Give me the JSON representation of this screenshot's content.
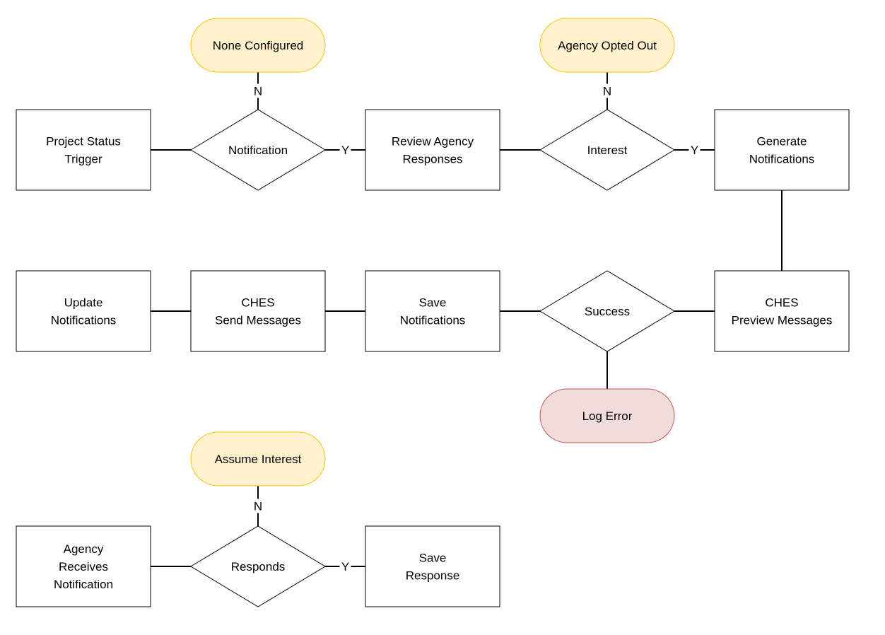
{
  "colors": {
    "terminator_fill": "#fff2cc",
    "terminator_stroke": "#f5c000",
    "error_fill": "#f2dcdb",
    "error_stroke": "#c0504d",
    "line": "#000000"
  },
  "nodes": {
    "project_status_trigger": {
      "type": "process",
      "lines": [
        "Project Status",
        "Trigger"
      ]
    },
    "notification": {
      "type": "decision",
      "lines": [
        "Notification"
      ]
    },
    "none_configured": {
      "type": "terminator",
      "lines": [
        "None Configured"
      ]
    },
    "review_agency_responses": {
      "type": "process",
      "lines": [
        "Review Agency",
        "Responses"
      ]
    },
    "interest": {
      "type": "decision",
      "lines": [
        "Interest"
      ]
    },
    "agency_opted_out": {
      "type": "terminator",
      "lines": [
        "Agency Opted Out"
      ]
    },
    "generate_notifications": {
      "type": "process",
      "lines": [
        "Generate",
        "Notifications"
      ]
    },
    "ches_preview_messages": {
      "type": "process",
      "lines": [
        "CHES",
        "Preview Messages"
      ]
    },
    "success": {
      "type": "decision",
      "lines": [
        "Success"
      ]
    },
    "log_error": {
      "type": "error",
      "lines": [
        "Log Error"
      ]
    },
    "save_notifications": {
      "type": "process",
      "lines": [
        "Save",
        "Notifications"
      ]
    },
    "ches_send_messages": {
      "type": "process",
      "lines": [
        "CHES",
        "Send Messages"
      ]
    },
    "update_notifications": {
      "type": "process",
      "lines": [
        "Update",
        "Notifications"
      ]
    },
    "agency_receives_notification": {
      "type": "process",
      "lines": [
        "Agency",
        "Receives",
        "Notification"
      ]
    },
    "responds": {
      "type": "decision",
      "lines": [
        "Responds"
      ]
    },
    "assume_interest": {
      "type": "terminator",
      "lines": [
        "Assume Interest"
      ]
    },
    "save_response": {
      "type": "process",
      "lines": [
        "Save",
        "Response"
      ]
    }
  },
  "edges": [
    {
      "from": "project_status_trigger",
      "to": "notification",
      "label": ""
    },
    {
      "from": "notification",
      "to": "none_configured",
      "label": "N"
    },
    {
      "from": "notification",
      "to": "review_agency_responses",
      "label": "Y"
    },
    {
      "from": "review_agency_responses",
      "to": "interest",
      "label": ""
    },
    {
      "from": "interest",
      "to": "agency_opted_out",
      "label": "N"
    },
    {
      "from": "interest",
      "to": "generate_notifications",
      "label": "Y"
    },
    {
      "from": "generate_notifications",
      "to": "ches_preview_messages",
      "label": ""
    },
    {
      "from": "ches_preview_messages",
      "to": "success",
      "label": ""
    },
    {
      "from": "success",
      "to": "log_error",
      "label": ""
    },
    {
      "from": "success",
      "to": "save_notifications",
      "label": ""
    },
    {
      "from": "save_notifications",
      "to": "ches_send_messages",
      "label": ""
    },
    {
      "from": "ches_send_messages",
      "to": "update_notifications",
      "label": ""
    },
    {
      "from": "agency_receives_notification",
      "to": "responds",
      "label": ""
    },
    {
      "from": "responds",
      "to": "assume_interest",
      "label": "N"
    },
    {
      "from": "responds",
      "to": "save_response",
      "label": "Y"
    }
  ]
}
